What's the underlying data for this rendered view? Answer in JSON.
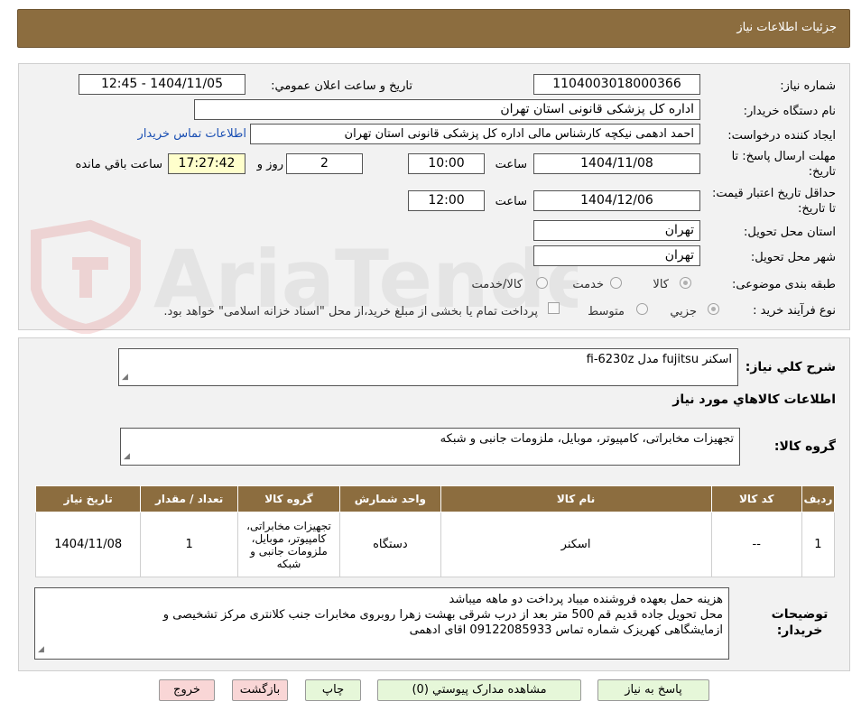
{
  "header": {
    "title": "جزئيات اطلاعات نياز"
  },
  "watermark": {
    "text": "AriaTender.net"
  },
  "form": {
    "need_number_label": "شماره نياز:",
    "need_number": "1104003018000366",
    "announce_label": "تاريخ و ساعت اعلان عمومي:",
    "announce_value": "1404/11/05 - 12:45",
    "buyer_org_label": "نام دستگاه خريدار:",
    "buyer_org": "اداره کل پزشکی قانونی استان تهران",
    "requester_label": "ايجاد کننده درخواست:",
    "requester": "احمد ادهمی نیکچه کارشناس مالی اداره کل پزشکی قانونی استان تهران",
    "contact_link": "اطلاعات تماس خريدار",
    "deadline_label": "مهلت ارسال پاسخ: تا تاريخ:",
    "deadline_date": "1404/11/08",
    "time_label": "ساعت",
    "deadline_time": "10:00",
    "days_value": "2",
    "days_label": "روز و",
    "remaining_time": "17:27:42",
    "remaining_label": "ساعت باقي مانده",
    "validity_label": "حداقل تاريخ اعتبار قيمت: تا تاريخ:",
    "validity_date": "1404/12/06",
    "validity_time": "12:00",
    "province_label": "استان محل تحويل:",
    "province": "تهران",
    "city_label": "شهر محل تحويل:",
    "city": "تهران",
    "category_label": "طبقه بندی موضوعی:",
    "category_options": [
      "کالا",
      "خدمت",
      "کالا/خدمت"
    ],
    "process_label": "نوع فرآيند خريد :",
    "process_options": [
      "جزيي",
      "متوسط"
    ],
    "payment_note": "پرداخت تمام يا بخشی از مبلغ خريد،از محل \"اسناد خزانه اسلامی\" خواهد بود."
  },
  "summary": {
    "label": "شرح کلي نياز:",
    "value": "اسکنر fujitsu مدل fi-6230z"
  },
  "goods": {
    "section_title": "اطلاعات کالاهاي مورد نياز",
    "group_label": "گروه کالا:",
    "group_value": "تجهیزات مخابراتی، کامپیوتر، موبایل، ملزومات جانبی و شبکه",
    "table": {
      "headers": [
        "رديف",
        "کد کالا",
        "نام کالا",
        "واحد شمارش",
        "گروه کالا",
        "تعداد / مقدار",
        "تاريخ نياز"
      ],
      "rows": [
        [
          "1",
          "--",
          "اسکنر",
          "دستگاه",
          "تجهیزات مخابراتی، کامپیوتر، موبایل، ملزومات جانبی و شبکه",
          "1",
          "1404/11/08"
        ]
      ]
    }
  },
  "buyer_notes": {
    "label": "توضيحات خريدار:",
    "lines": [
      "هزینه حمل بعهده فروشنده میباد پرداخت دو ماهه میباشد",
      "محل تحویل جاده قدیم قم 500 متر بعد از درب شرقی بهشت زهرا روبروی مخابرات جنب کلانتری مرکز تشخیصی و",
      "ازمایشگاهی کهریزک شماره تماس 09122085933 اقای ادهمی"
    ]
  },
  "buttons": {
    "respond": "پاسخ به نياز",
    "attachments": "مشاهده مدارک پيوستي (0)",
    "print": "چاپ",
    "back": "بازگشت",
    "exit": "خروج"
  }
}
